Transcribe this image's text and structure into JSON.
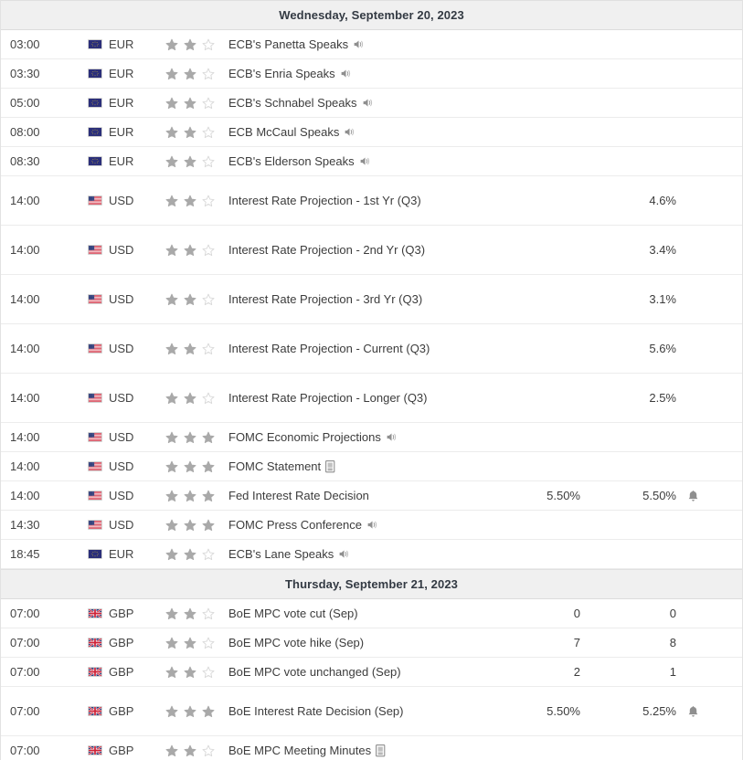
{
  "colors": {
    "day_header_bg": "#f0f0f0",
    "day_header_text": "#333a43",
    "row_text": "#3c3c3c",
    "star_filled": "#a9a9a9",
    "star_empty": "#d8d8d8",
    "border": "#ececec",
    "icon_gray": "#8f8f8f"
  },
  "sections": [
    {
      "date_label": "Wednesday, September 20, 2023",
      "rows": [
        {
          "time": "03:00",
          "currency": "EUR",
          "flag": "eu-flag-icon",
          "stars": 2,
          "event": "ECB's Panetta Speaks",
          "icon": "speaker-icon",
          "actual": "",
          "forecast": "",
          "bell": false,
          "two_line": false
        },
        {
          "time": "03:30",
          "currency": "EUR",
          "flag": "eu-flag-icon",
          "stars": 2,
          "event": "ECB's Enria Speaks",
          "icon": "speaker-icon",
          "actual": "",
          "forecast": "",
          "bell": false,
          "two_line": false
        },
        {
          "time": "05:00",
          "currency": "EUR",
          "flag": "eu-flag-icon",
          "stars": 2,
          "event": "ECB's Schnabel Speaks",
          "icon": "speaker-icon",
          "actual": "",
          "forecast": "",
          "bell": false,
          "two_line": false
        },
        {
          "time": "08:00",
          "currency": "EUR",
          "flag": "eu-flag-icon",
          "stars": 2,
          "event": "ECB McCaul Speaks",
          "icon": "speaker-icon",
          "actual": "",
          "forecast": "",
          "bell": false,
          "two_line": false
        },
        {
          "time": "08:30",
          "currency": "EUR",
          "flag": "eu-flag-icon",
          "stars": 2,
          "event": "ECB's Elderson Speaks",
          "icon": "speaker-icon",
          "actual": "",
          "forecast": "",
          "bell": false,
          "two_line": false
        },
        {
          "time": "14:00",
          "currency": "USD",
          "flag": "us-flag-icon",
          "stars": 2,
          "event": "Interest Rate Projection - 1st Yr (Q3)",
          "icon": "",
          "actual": "",
          "forecast": "4.6%",
          "bell": false,
          "two_line": true
        },
        {
          "time": "14:00",
          "currency": "USD",
          "flag": "us-flag-icon",
          "stars": 2,
          "event": "Interest Rate Projection - 2nd Yr (Q3)",
          "icon": "",
          "actual": "",
          "forecast": "3.4%",
          "bell": false,
          "two_line": true
        },
        {
          "time": "14:00",
          "currency": "USD",
          "flag": "us-flag-icon",
          "stars": 2,
          "event": "Interest Rate Projection - 3rd Yr (Q3)",
          "icon": "",
          "actual": "",
          "forecast": "3.1%",
          "bell": false,
          "two_line": true
        },
        {
          "time": "14:00",
          "currency": "USD",
          "flag": "us-flag-icon",
          "stars": 2,
          "event": "Interest Rate Projection - Current (Q3)",
          "icon": "",
          "actual": "",
          "forecast": "5.6%",
          "bell": false,
          "two_line": true
        },
        {
          "time": "14:00",
          "currency": "USD",
          "flag": "us-flag-icon",
          "stars": 2,
          "event": "Interest Rate Projection - Longer (Q3)",
          "icon": "",
          "actual": "",
          "forecast": "2.5%",
          "bell": false,
          "two_line": true
        },
        {
          "time": "14:00",
          "currency": "USD",
          "flag": "us-flag-icon",
          "stars": 3,
          "event": "FOMC Economic Projections",
          "icon": "speaker-icon",
          "actual": "",
          "forecast": "",
          "bell": false,
          "two_line": false
        },
        {
          "time": "14:00",
          "currency": "USD",
          "flag": "us-flag-icon",
          "stars": 3,
          "event": "FOMC Statement",
          "icon": "document-icon",
          "actual": "",
          "forecast": "",
          "bell": false,
          "two_line": false
        },
        {
          "time": "14:00",
          "currency": "USD",
          "flag": "us-flag-icon",
          "stars": 3,
          "event": "Fed Interest Rate Decision",
          "icon": "",
          "actual": "5.50%",
          "forecast": "5.50%",
          "bell": true,
          "two_line": false
        },
        {
          "time": "14:30",
          "currency": "USD",
          "flag": "us-flag-icon",
          "stars": 3,
          "event": "FOMC Press Conference",
          "icon": "speaker-icon",
          "actual": "",
          "forecast": "",
          "bell": false,
          "two_line": false
        },
        {
          "time": "18:45",
          "currency": "EUR",
          "flag": "eu-flag-icon",
          "stars": 2,
          "event": "ECB's Lane Speaks",
          "icon": "speaker-icon",
          "actual": "",
          "forecast": "",
          "bell": false,
          "two_line": false
        }
      ]
    },
    {
      "date_label": "Thursday, September 21, 2023",
      "rows": [
        {
          "time": "07:00",
          "currency": "GBP",
          "flag": "gb-flag-icon",
          "stars": 2,
          "event": "BoE MPC vote cut (Sep)",
          "icon": "",
          "actual": "0",
          "forecast": "0",
          "bell": false,
          "two_line": false
        },
        {
          "time": "07:00",
          "currency": "GBP",
          "flag": "gb-flag-icon",
          "stars": 2,
          "event": "BoE MPC vote hike (Sep)",
          "icon": "",
          "actual": "7",
          "forecast": "8",
          "bell": false,
          "two_line": false
        },
        {
          "time": "07:00",
          "currency": "GBP",
          "flag": "gb-flag-icon",
          "stars": 2,
          "event": "BoE MPC vote unchanged (Sep)",
          "icon": "",
          "actual": "2",
          "forecast": "1",
          "bell": false,
          "two_line": false
        },
        {
          "time": "07:00",
          "currency": "GBP",
          "flag": "gb-flag-icon",
          "stars": 3,
          "event": "BoE Interest Rate Decision (Sep)",
          "icon": "",
          "actual": "5.50%",
          "forecast": "5.25%",
          "bell": true,
          "two_line": true
        },
        {
          "time": "07:00",
          "currency": "GBP",
          "flag": "gb-flag-icon",
          "stars": 2,
          "event": "BoE MPC Meeting Minutes",
          "icon": "document-icon",
          "actual": "",
          "forecast": "",
          "bell": false,
          "two_line": false
        }
      ]
    }
  ]
}
